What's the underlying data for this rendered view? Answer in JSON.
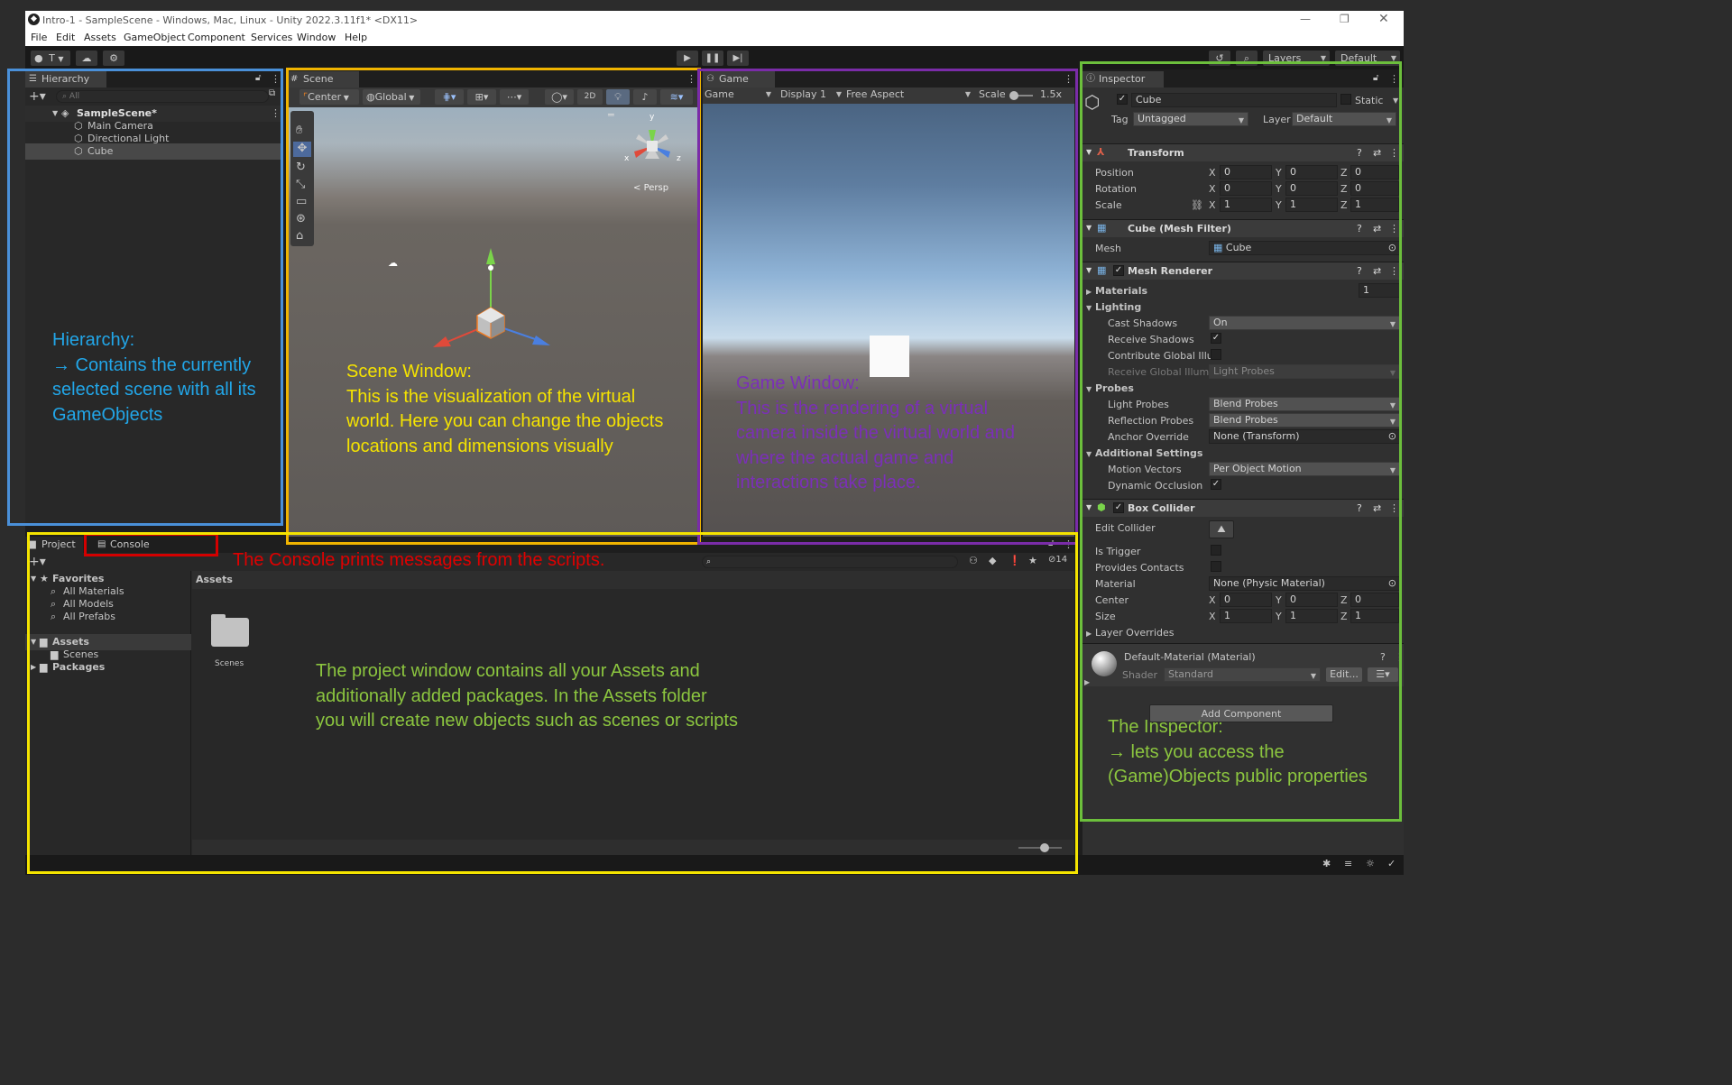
{
  "titlebar": {
    "title": "Intro-1 - SampleScene - Windows, Mac, Linux - Unity 2022.3.11f1* <DX11>"
  },
  "menu": [
    "File",
    "Edit",
    "Assets",
    "GameObject",
    "Component",
    "Services",
    "Window",
    "Help"
  ],
  "toolbar": {
    "account": "T",
    "layers": "Layers",
    "layout": "Default"
  },
  "hierarchy": {
    "tab": "Hierarchy",
    "search_placeholder": "All",
    "scene": "SampleScene*",
    "items": [
      "Main Camera",
      "Directional Light",
      "Cube"
    ]
  },
  "scene": {
    "tab": "Scene",
    "pivot": "Center",
    "space": "Global",
    "mode_2d": "2D",
    "persp": "Persp",
    "gizmo_axes": [
      "y",
      "x",
      "z"
    ]
  },
  "game": {
    "tab": "Game",
    "view": "Game",
    "display": "Display 1",
    "aspect": "Free Aspect",
    "scale_label": "Scale",
    "scale_value": "1.5x"
  },
  "project": {
    "tabs": [
      "Project",
      "Console"
    ],
    "favorites_label": "Favorites",
    "favorites": [
      "All Materials",
      "All Models",
      "All Prefabs"
    ],
    "assets_label": "Assets",
    "assets_children": [
      "Scenes"
    ],
    "packages_label": "Packages",
    "breadcrumb": "Assets",
    "folder_items": [
      "Scenes"
    ],
    "hidden_count": "14"
  },
  "inspector": {
    "tab": "Inspector",
    "object_name": "Cube",
    "static_label": "Static",
    "tag_label": "Tag",
    "tag_value": "Untagged",
    "layer_label": "Layer",
    "layer_value": "Default",
    "transform": {
      "title": "Transform",
      "rows": [
        {
          "label": "Position",
          "x": "0",
          "y": "0",
          "z": "0"
        },
        {
          "label": "Rotation",
          "x": "0",
          "y": "0",
          "z": "0"
        },
        {
          "label": "Scale",
          "x": "1",
          "y": "1",
          "z": "1"
        }
      ]
    },
    "mesh_filter": {
      "title": "Cube (Mesh Filter)",
      "mesh_label": "Mesh",
      "mesh_value": "Cube"
    },
    "mesh_renderer": {
      "title": "Mesh Renderer",
      "materials_label": "Materials",
      "materials_count": "1",
      "lighting_label": "Lighting",
      "cast_shadows_label": "Cast Shadows",
      "cast_shadows_value": "On",
      "receive_shadows_label": "Receive Shadows",
      "contribute_gi_label": "Contribute Global Illu",
      "receive_gi_label": "Receive Global Illumi",
      "receive_gi_value": "Light Probes",
      "probes_label": "Probes",
      "light_probes_label": "Light Probes",
      "light_probes_value": "Blend Probes",
      "reflection_probes_label": "Reflection Probes",
      "reflection_probes_value": "Blend Probes",
      "anchor_override_label": "Anchor Override",
      "anchor_override_value": "None (Transform)",
      "additional_label": "Additional Settings",
      "motion_vectors_label": "Motion Vectors",
      "motion_vectors_value": "Per Object Motion",
      "dynamic_occlusion_label": "Dynamic Occlusion"
    },
    "box_collider": {
      "title": "Box Collider",
      "edit_collider_label": "Edit Collider",
      "is_trigger_label": "Is Trigger",
      "provides_contacts_label": "Provides Contacts",
      "material_label": "Material",
      "material_value": "None (Physic Material)",
      "center_label": "Center",
      "center": {
        "x": "0",
        "y": "0",
        "z": "0"
      },
      "size_label": "Size",
      "size": {
        "x": "1",
        "y": "1",
        "z": "1"
      },
      "layer_overrides_label": "Layer Overrides"
    },
    "material": {
      "title": "Default-Material (Material)",
      "shader_label": "Shader",
      "shader_value": "Standard",
      "edit_label": "Edit..."
    },
    "add_component": "Add Component"
  },
  "annotations": {
    "hierarchy": "Hierarchy:\n→ Contains the currently selected scene with all its GameObjects",
    "scene": "Scene Window:\nThis is the visualization of the virtual world. Here you can change the objects locations and dimensions visually",
    "game": "Game Window:\nThis is the rendering of a virtual camera inside the virtual world and where the actual game and interactions take place.",
    "console": "The Console prints messages from the scripts.",
    "project": "The project window contains all your Assets and additionally added packages. In the Assets folder you will create new objects such as scenes or scripts",
    "inspector": "The Inspector:\n→ lets you access the (Game)Objects public properties"
  },
  "colors": {
    "hierarchy_box": "#4a90d9",
    "scene_box": "#f0b400",
    "game_box": "#7a2ca8",
    "console_box": "#d40000",
    "project_box": "#f5e400",
    "inspector_box": "#6cbf3c",
    "hierarchy_text": "#22a6e8",
    "scene_text": "#f5e300",
    "game_text": "#7b2fb8",
    "console_text": "#e00000",
    "project_text": "#8cc63f",
    "inspector_text": "#8cc63f"
  }
}
